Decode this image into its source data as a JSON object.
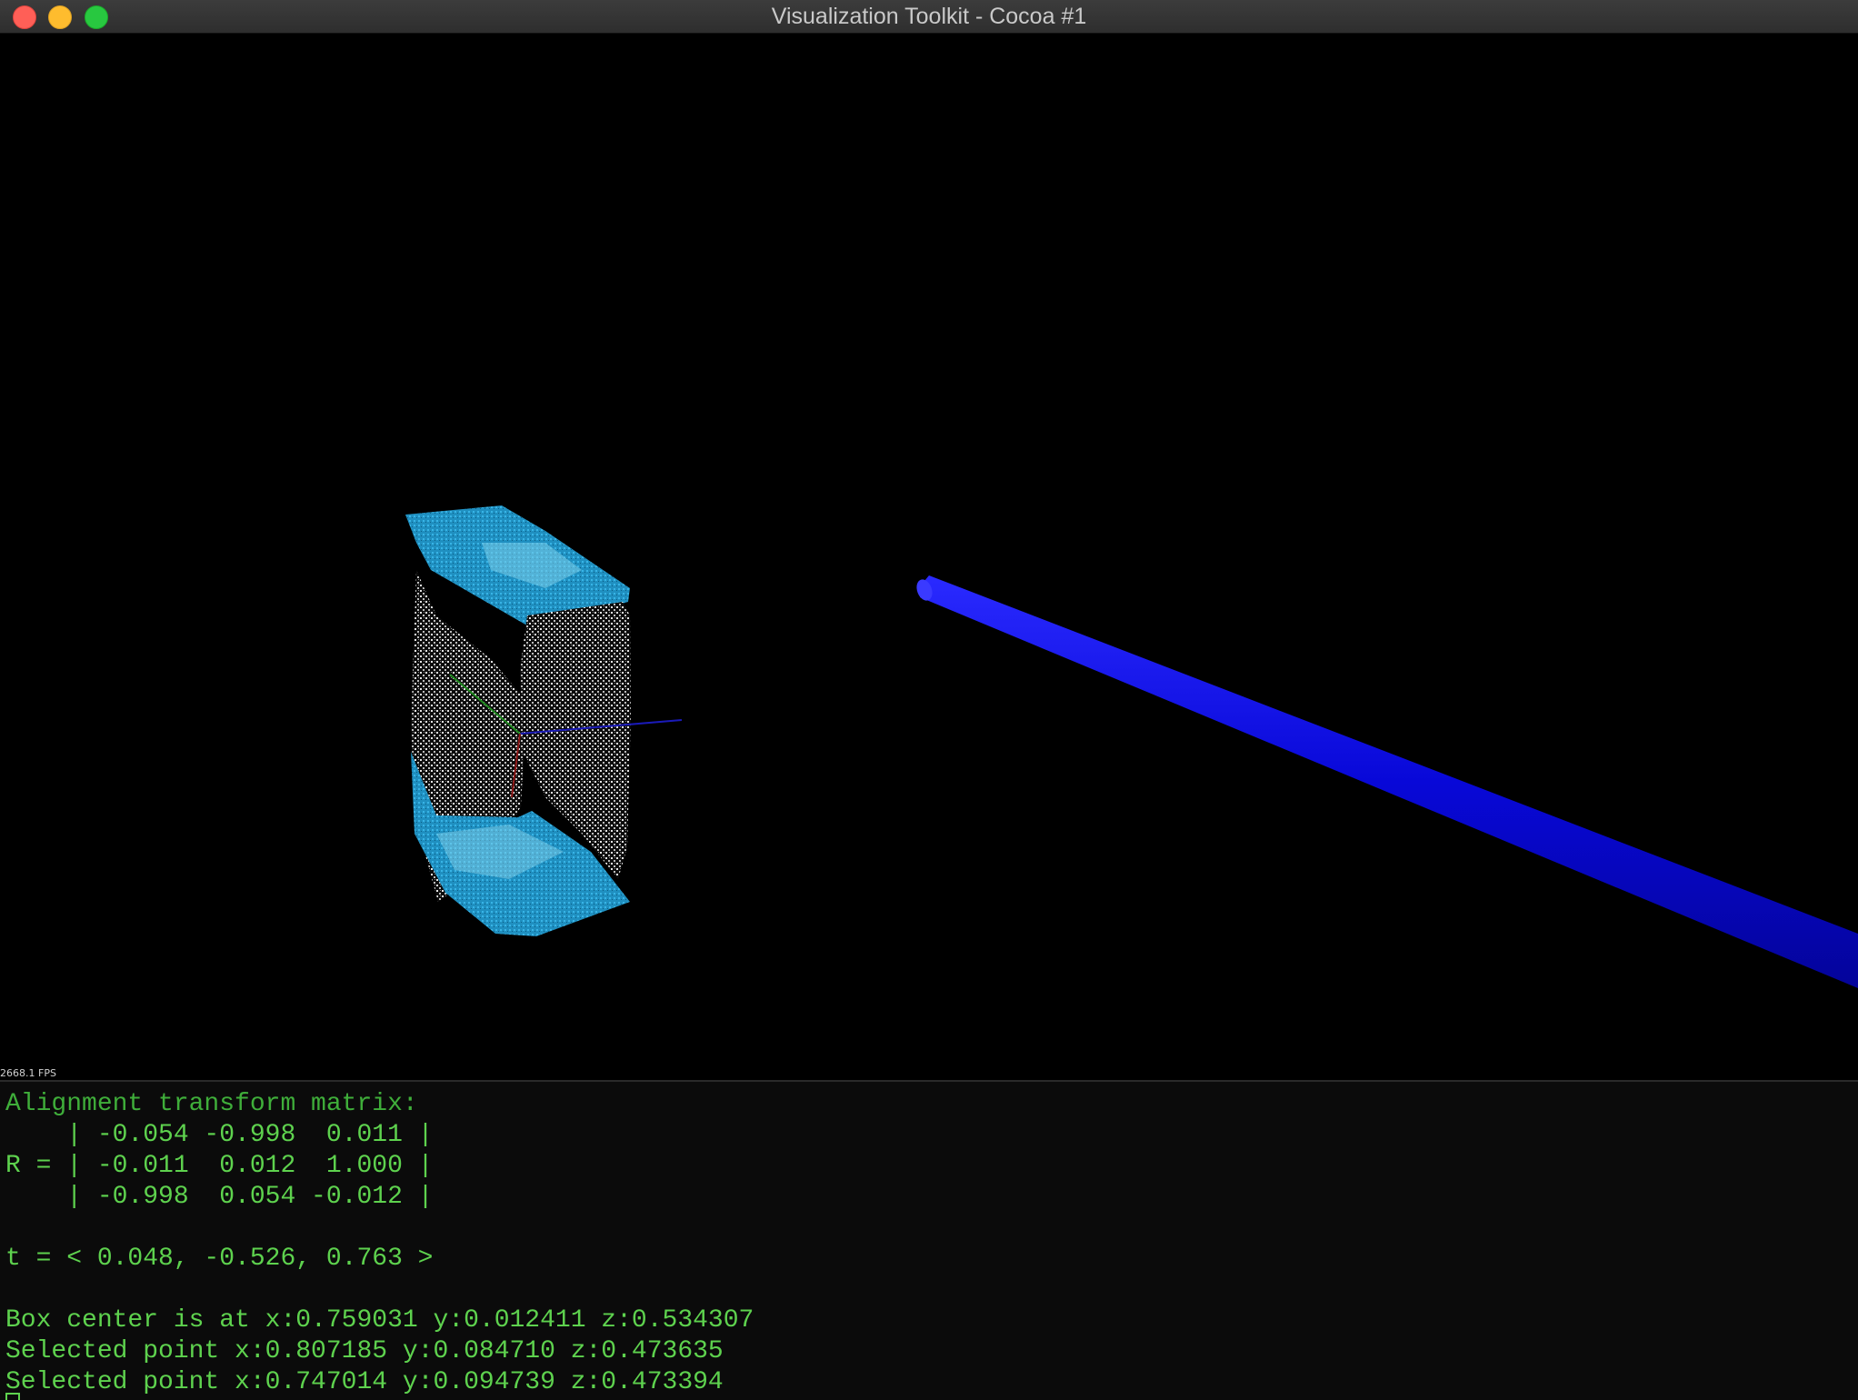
{
  "window": {
    "title": "Visualization Toolkit - Cocoa #1"
  },
  "viewport": {
    "fps_label": "2668.1 FPS",
    "background": "#000000",
    "point_cloud_color": "#2aa8d8",
    "point_cloud_highlight": "#d8d8d8",
    "cylinder_color": "#0a0ae0"
  },
  "terminal": {
    "lines": [
      "Alignment transform matrix:",
      "    | -0.054 -0.998  0.011 |",
      "R = | -0.011  0.012  1.000 |",
      "    | -0.998  0.054 -0.012 |",
      "",
      "t = < 0.048, -0.526, 0.763 >",
      "",
      "Box center is at x:0.759031 y:0.012411 z:0.534307",
      "Selected point x:0.807185 y:0.084710 z:0.473635",
      "Selected point x:0.747014 y:0.094739 z:0.473394"
    ]
  }
}
